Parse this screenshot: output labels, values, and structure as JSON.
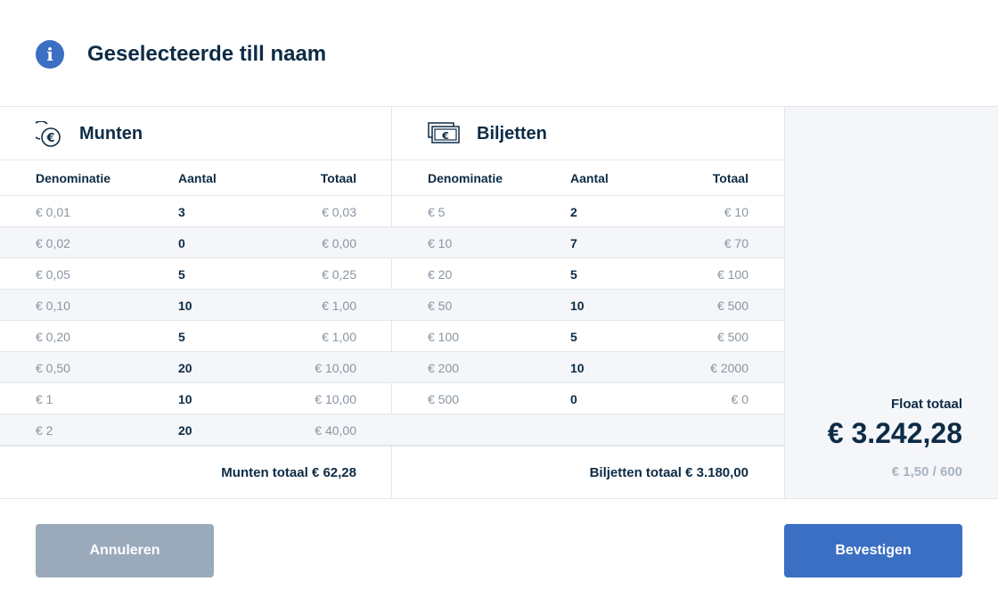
{
  "header": {
    "title": "Geselecteerde till naam",
    "icon": "info-icon"
  },
  "columns": {
    "denomination": "Denominatie",
    "count": "Aantal",
    "total": "Totaal"
  },
  "coins": {
    "title": "Munten",
    "icon": "coins-euro-icon",
    "rows": [
      {
        "denomination": "€ 0,01",
        "count": "3",
        "total": "€ 0,03"
      },
      {
        "denomination": "€ 0,02",
        "count": "0",
        "total": "€ 0,00"
      },
      {
        "denomination": "€ 0,05",
        "count": "5",
        "total": "€ 0,25"
      },
      {
        "denomination": "€ 0,10",
        "count": "10",
        "total": "€ 1,00"
      },
      {
        "denomination": "€ 0,20",
        "count": "5",
        "total": "€ 1,00"
      },
      {
        "denomination": "€ 0,50",
        "count": "20",
        "total": "€ 10,00"
      },
      {
        "denomination": "€ 1",
        "count": "10",
        "total": "€ 10,00"
      },
      {
        "denomination": "€ 2",
        "count": "20",
        "total": "€ 40,00"
      }
    ],
    "footer_total": "Munten totaal € 62,28"
  },
  "notes": {
    "title": "Biljetten",
    "icon": "banknotes-euro-icon",
    "rows": [
      {
        "denomination": "€ 5",
        "count": "2",
        "total": "€ 10"
      },
      {
        "denomination": "€ 10",
        "count": "7",
        "total": "€ 70"
      },
      {
        "denomination": "€ 20",
        "count": "5",
        "total": "€ 100"
      },
      {
        "denomination": "€ 50",
        "count": "10",
        "total": "€ 500"
      },
      {
        "denomination": "€ 100",
        "count": "5",
        "total": "€ 500"
      },
      {
        "denomination": "€ 200",
        "count": "10",
        "total": "€ 2000"
      },
      {
        "denomination": "€ 500",
        "count": "0",
        "total": "€ 0"
      },
      {
        "denomination": "",
        "count": "",
        "total": ""
      }
    ],
    "footer_total": "Biljetten totaal € 3.180,00"
  },
  "summary": {
    "label": "Float totaal",
    "amount": "€ 3.242,28",
    "sub": "€ 1,50 / 600"
  },
  "actions": {
    "cancel": "Annuleren",
    "confirm": "Bevestigen"
  },
  "colors": {
    "primary": "#3a6fc4",
    "disabled": "#9aaabb",
    "text": "#0d2b45",
    "muted": "#8a95a2",
    "alt_row": "#f4f6f9"
  }
}
